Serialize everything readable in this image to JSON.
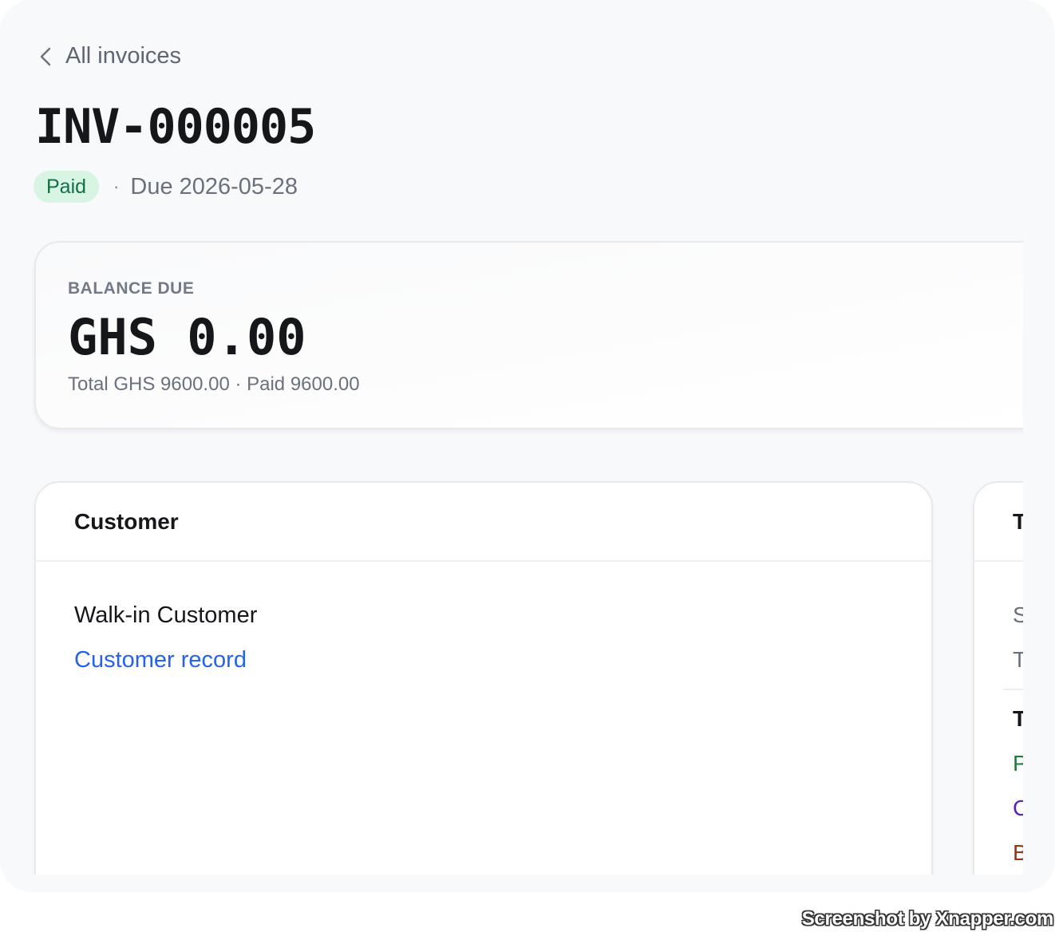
{
  "nav": {
    "back_label": "All invoices"
  },
  "invoice": {
    "number": "INV-000005",
    "status": "Paid",
    "separator": "·",
    "due_text": "Due 2026-05-28"
  },
  "balance": {
    "label": "BALANCE DUE",
    "amount": "GHS 0.00",
    "summary": "Total GHS 9600.00 · Paid 9600.00"
  },
  "customer_card": {
    "title": "Customer",
    "customer_name": "Walk-in Customer",
    "record_link": "Customer record"
  },
  "totals_card": {
    "title_visible": "T",
    "rows_visible": [
      "S",
      "T",
      "T",
      "P",
      "C",
      "B"
    ]
  },
  "colors": {
    "page_bg": "#f8f9fb",
    "paid_badge_bg": "#d8f5e4",
    "paid_badge_text": "#137042",
    "link": "#2563eb",
    "paid_row": "#15803d",
    "credit_row": "#5b21b6",
    "balance_row": "#9a3412"
  },
  "watermark": "Screenshot by Xnapper.com"
}
